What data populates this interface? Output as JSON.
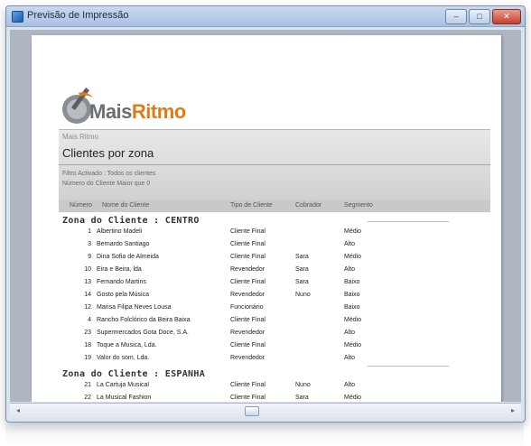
{
  "window": {
    "title": "Previsão de Impressão",
    "minimize": "–",
    "maximize": "□",
    "close": "✕"
  },
  "logo": {
    "part1": "Mais",
    "part2": "Ritmo"
  },
  "report": {
    "company": "Mais Ritmo",
    "title": "Clientes por zona",
    "filter_line1": "Filtro Activado : Todos os clientes",
    "filter_line2": "Número do Cliente Maior que 0"
  },
  "columns": {
    "numero": "Número",
    "nome": "Nome do Cliente",
    "tipo": "Tipo de Cliente",
    "cobrador": "Cobrador",
    "segmento": "Segmento"
  },
  "zones": [
    {
      "label": "Zona do Cliente : CENTRO",
      "rows": [
        {
          "num": "1",
          "name": "Albertino Madeli",
          "tipo": "Cliente Final",
          "cobrador": "",
          "segmento": "Médio"
        },
        {
          "num": "3",
          "name": "Bernardo Santiago",
          "tipo": "Cliente Final",
          "cobrador": "",
          "segmento": "Alto"
        },
        {
          "num": "9",
          "name": "Dina Sofia de Almeida",
          "tipo": "Cliente Final",
          "cobrador": "Sara",
          "segmento": "Médio"
        },
        {
          "num": "10",
          "name": "Eira e Beira, lda",
          "tipo": "Revendedor",
          "cobrador": "Sara",
          "segmento": "Alto"
        },
        {
          "num": "13",
          "name": "Fernando Martins",
          "tipo": "Cliente Final",
          "cobrador": "Sara",
          "segmento": "Baixo"
        },
        {
          "num": "14",
          "name": "Gosto pela Música",
          "tipo": "Revendedor",
          "cobrador": "Nuno",
          "segmento": "Baixo"
        },
        {
          "num": "12",
          "name": "Marisa Filipa Neves Lousa",
          "tipo": "Funcionário",
          "cobrador": "",
          "segmento": "Baixo"
        },
        {
          "num": "4",
          "name": "Rancho Folclórico da Beira Baixa",
          "tipo": "Cliente Final",
          "cobrador": "",
          "segmento": "Médio"
        },
        {
          "num": "23",
          "name": "Supermercados Gota Doce, S.A.",
          "tipo": "Revendedor",
          "cobrador": "",
          "segmento": "Alto"
        },
        {
          "num": "18",
          "name": "Toque a Musica, Lda.",
          "tipo": "Cliente Final",
          "cobrador": "",
          "segmento": "Médio"
        },
        {
          "num": "19",
          "name": "Valor do som, Lda.",
          "tipo": "Revendedor",
          "cobrador": "",
          "segmento": "Alto"
        }
      ]
    },
    {
      "label": "Zona do Cliente : ESPANHA",
      "rows": [
        {
          "num": "21",
          "name": "La Cartuja Musical",
          "tipo": "Cliente Final",
          "cobrador": "Nuno",
          "segmento": "Alto"
        },
        {
          "num": "22",
          "name": "La Musical Fashion",
          "tipo": "Cliente Final",
          "cobrador": "Sara",
          "segmento": "Médio"
        }
      ]
    }
  ],
  "colors": {
    "accent": "#e07a14",
    "logo_gray": "#6b6e73",
    "titlebar": "#b9cde8",
    "close_button": "#c4412e"
  },
  "icons": {
    "app": "app-window-icon",
    "scroll_left": "chevron-left-icon",
    "scroll_right": "chevron-right-icon"
  }
}
